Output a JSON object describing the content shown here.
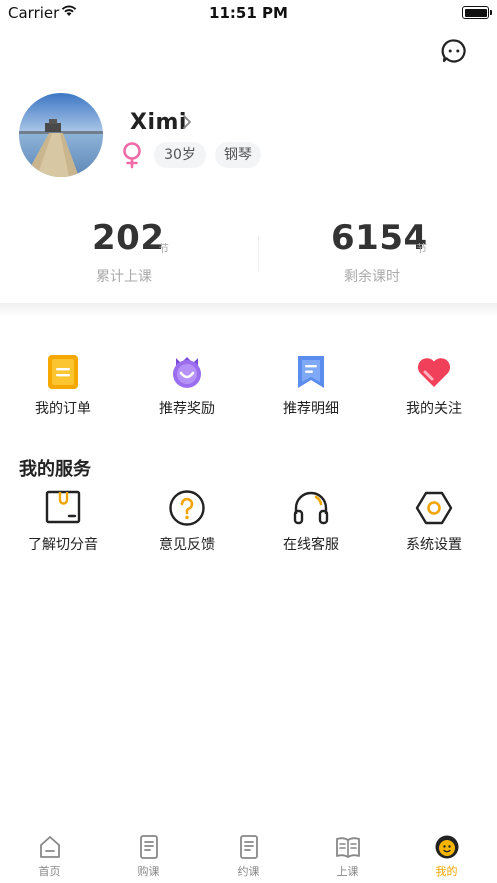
{
  "status_bar": {
    "carrier": "Carrier",
    "time": "11:51 PM"
  },
  "profile": {
    "name": "Ximi",
    "age": "30岁",
    "instrument": "钢琴"
  },
  "stats": {
    "attended": {
      "value": "202",
      "unit": "节",
      "label": "累计上课"
    },
    "remaining": {
      "value": "6154",
      "unit": "节",
      "label": "剩余课时"
    }
  },
  "quick_actions": [
    {
      "label": "我的订单",
      "icon": "orders-icon"
    },
    {
      "label": "推荐奖励",
      "icon": "referral-reward-icon"
    },
    {
      "label": "推荐明细",
      "icon": "referral-details-icon"
    },
    {
      "label": "我的关注",
      "icon": "heart-icon"
    }
  ],
  "services": {
    "title": "我的服务",
    "items": [
      {
        "label": "了解切分音",
        "icon": "syncopation-icon"
      },
      {
        "label": "意见反馈",
        "icon": "feedback-icon"
      },
      {
        "label": "在线客服",
        "icon": "headset-icon"
      },
      {
        "label": "系统设置",
        "icon": "settings-icon"
      }
    ]
  },
  "tabbar": {
    "active": "我的",
    "items": [
      {
        "label": "首页",
        "icon": "home-icon"
      },
      {
        "label": "购课",
        "icon": "buy-course-icon"
      },
      {
        "label": "约课",
        "icon": "book-class-icon"
      },
      {
        "label": "上课",
        "icon": "attend-class-icon"
      },
      {
        "label": "我的",
        "icon": "profile-icon"
      }
    ]
  },
  "colors": {
    "accent": "#f0a500",
    "purple": "#8b5cf6",
    "pink": "#f06ba8",
    "red": "#f0405a"
  }
}
